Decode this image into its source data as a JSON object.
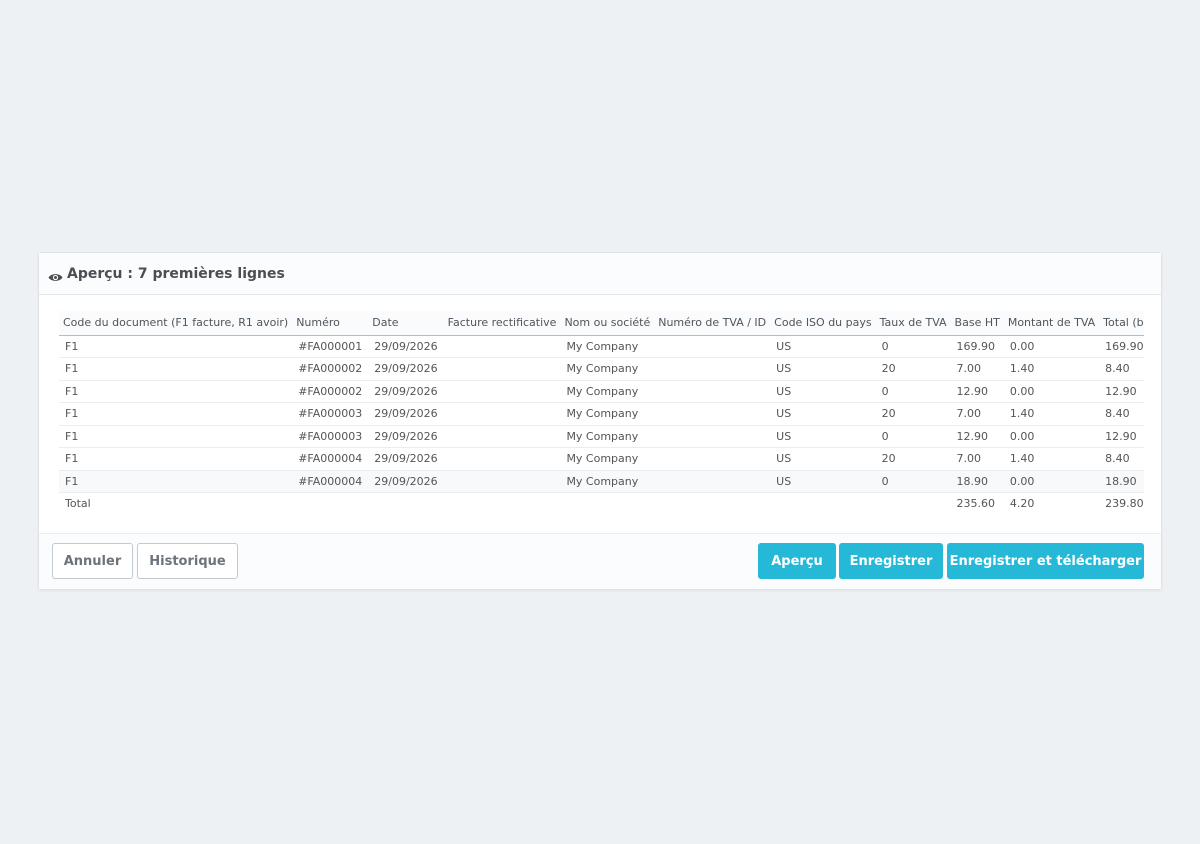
{
  "panel": {
    "title": "Aperçu : 7 premières lignes"
  },
  "table": {
    "columns": [
      "Code du document (F1 facture, R1 avoir)",
      "Numéro",
      "Date",
      "Facture rectificative",
      "Nom ou société",
      "Numéro de TVA / ID",
      "Code ISO du pays",
      "Taux de TVA",
      "Base HT",
      "Montant de TVA",
      "Total (base + TVA)"
    ],
    "rows": [
      [
        "F1",
        "#FA000001",
        "29/09/2026",
        "",
        "My Company",
        "",
        "US",
        "0",
        "169.90",
        "0.00",
        "169.90"
      ],
      [
        "F1",
        "#FA000002",
        "29/09/2026",
        "",
        "My Company",
        "",
        "US",
        "20",
        "7.00",
        "1.40",
        "8.40"
      ],
      [
        "F1",
        "#FA000002",
        "29/09/2026",
        "",
        "My Company",
        "",
        "US",
        "0",
        "12.90",
        "0.00",
        "12.90"
      ],
      [
        "F1",
        "#FA000003",
        "29/09/2026",
        "",
        "My Company",
        "",
        "US",
        "20",
        "7.00",
        "1.40",
        "8.40"
      ],
      [
        "F1",
        "#FA000003",
        "29/09/2026",
        "",
        "My Company",
        "",
        "US",
        "0",
        "12.90",
        "0.00",
        "12.90"
      ],
      [
        "F1",
        "#FA000004",
        "29/09/2026",
        "",
        "My Company",
        "",
        "US",
        "20",
        "7.00",
        "1.40",
        "8.40"
      ],
      [
        "F1",
        "#FA000004",
        "29/09/2026",
        "",
        "My Company",
        "",
        "US",
        "0",
        "18.90",
        "0.00",
        "18.90"
      ]
    ],
    "total": [
      "Total",
      "",
      "",
      "",
      "",
      "",
      "",
      "",
      "235.60",
      "4.20",
      "239.80"
    ]
  },
  "footer": {
    "cancel_label": "Annuler",
    "history_label": "Historique",
    "preview_label": "Aperçu",
    "save_label": "Enregistrer",
    "save_download_label": "Enregistrer et télécharger"
  },
  "colors": {
    "primary": "#25b9d7",
    "background": "#eef1f4"
  },
  "icons": {
    "header": "eye-icon"
  }
}
